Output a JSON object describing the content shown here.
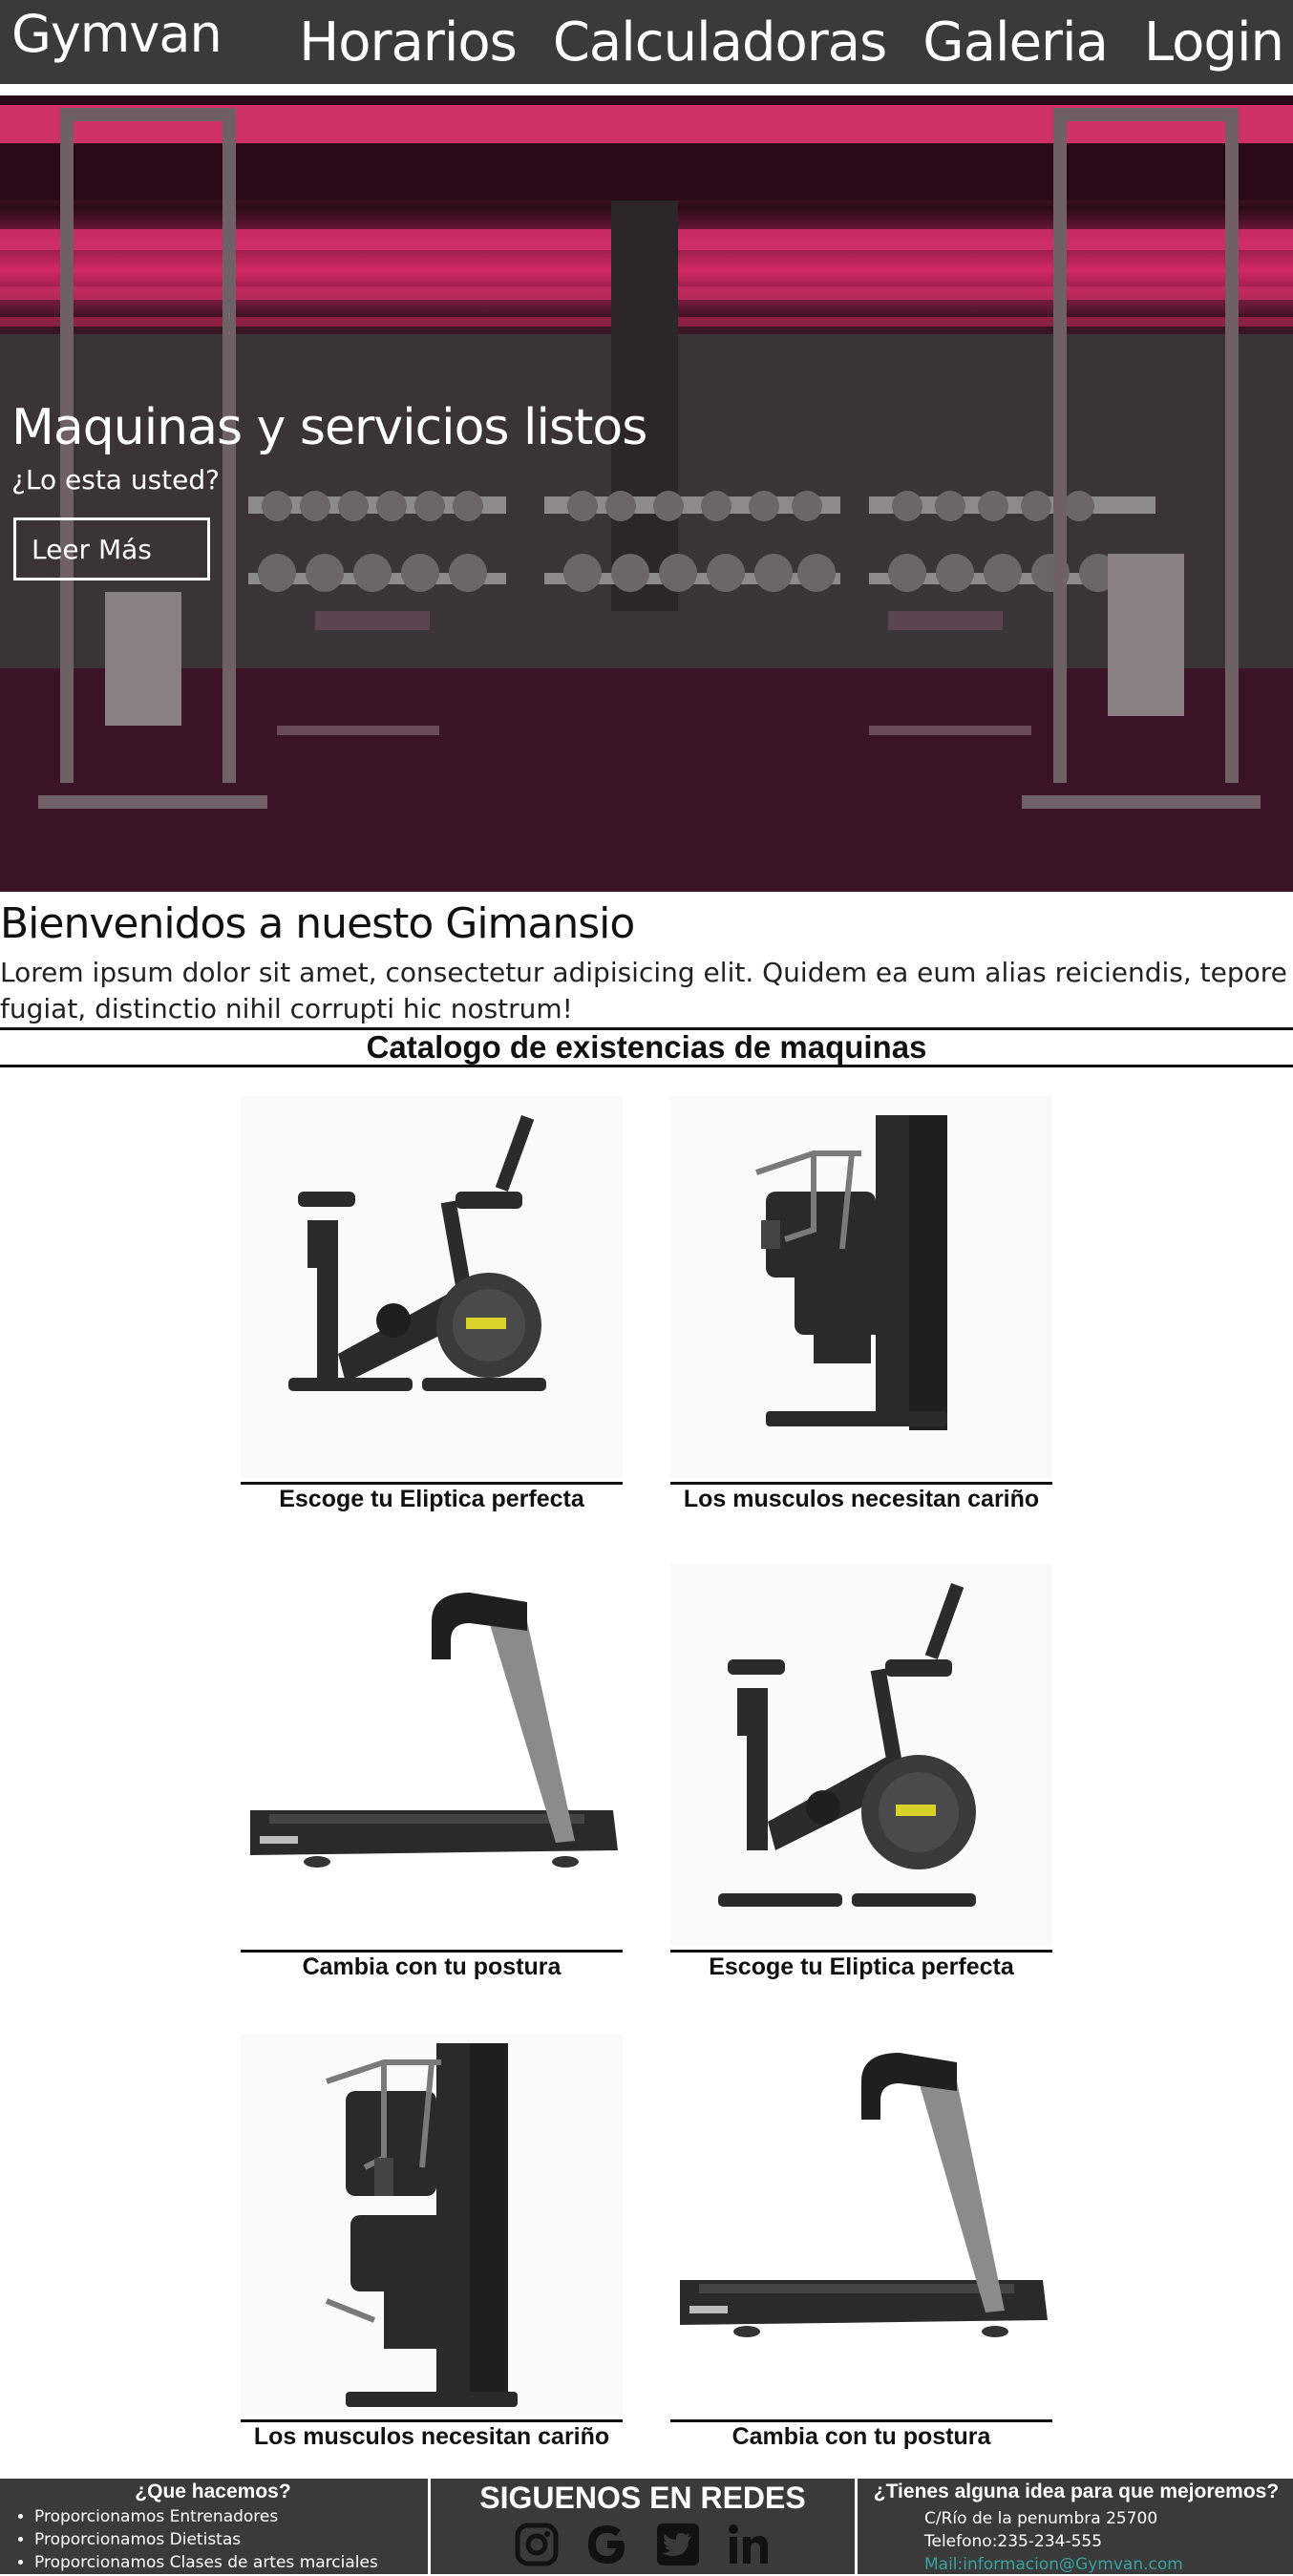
{
  "header": {
    "brand": "Gymvan",
    "nav": [
      "Horarios",
      "Calculadoras",
      "Galeria",
      "Login"
    ]
  },
  "hero": {
    "title": "Maquinas y servicios listos",
    "subtitle": "¿Lo esta usted?",
    "button": "Leer Más"
  },
  "welcome": {
    "title": "Bienvenidos a nuesto Gimansio",
    "text": "Lorem ipsum dolor sit amet, consectetur adipisicing elit. Quidem ea eum alias reiciendis, tepore fugiat, distinctio nihil corrupti hic nostrum!"
  },
  "catalog": {
    "title": "Catalogo de existencias de maquinas",
    "items": [
      {
        "caption": "Escoge tu Eliptica perfecta",
        "image": "spin-bike"
      },
      {
        "caption": "Los musculos necesitan cariño",
        "image": "chest-press-machine"
      },
      {
        "caption": "Cambia con tu postura",
        "image": "treadmill"
      },
      {
        "caption": "Escoge tu Eliptica perfecta",
        "image": "spin-bike"
      },
      {
        "caption": "Los musculos necesitan cariño",
        "image": "chest-press-machine"
      },
      {
        "caption": "Cambia con tu postura",
        "image": "treadmill"
      }
    ]
  },
  "footer": {
    "what_we_do": {
      "title": "¿Que hacemos?",
      "items": [
        "Proporcionamos Entrenadores",
        "Proporcionamos Dietistas",
        "Proporcionamos Clases de artes marciales"
      ]
    },
    "social": {
      "title": "SIGUENOS EN REDES",
      "icons": [
        "instagram-icon",
        "google-icon",
        "twitter-icon",
        "linkedin-icon"
      ]
    },
    "contact": {
      "title": "¿Tienes alguna idea para que mejoremos?",
      "address": "C/Río de la penumbra 25700",
      "phone": "Telefono:235-234-555",
      "mail": "Mail:informacion@Gymvan.com"
    }
  },
  "colors": {
    "header_bg": "#3a3a3a",
    "hero_accent": "#e0336f",
    "mail_link": "#36a3a0"
  }
}
